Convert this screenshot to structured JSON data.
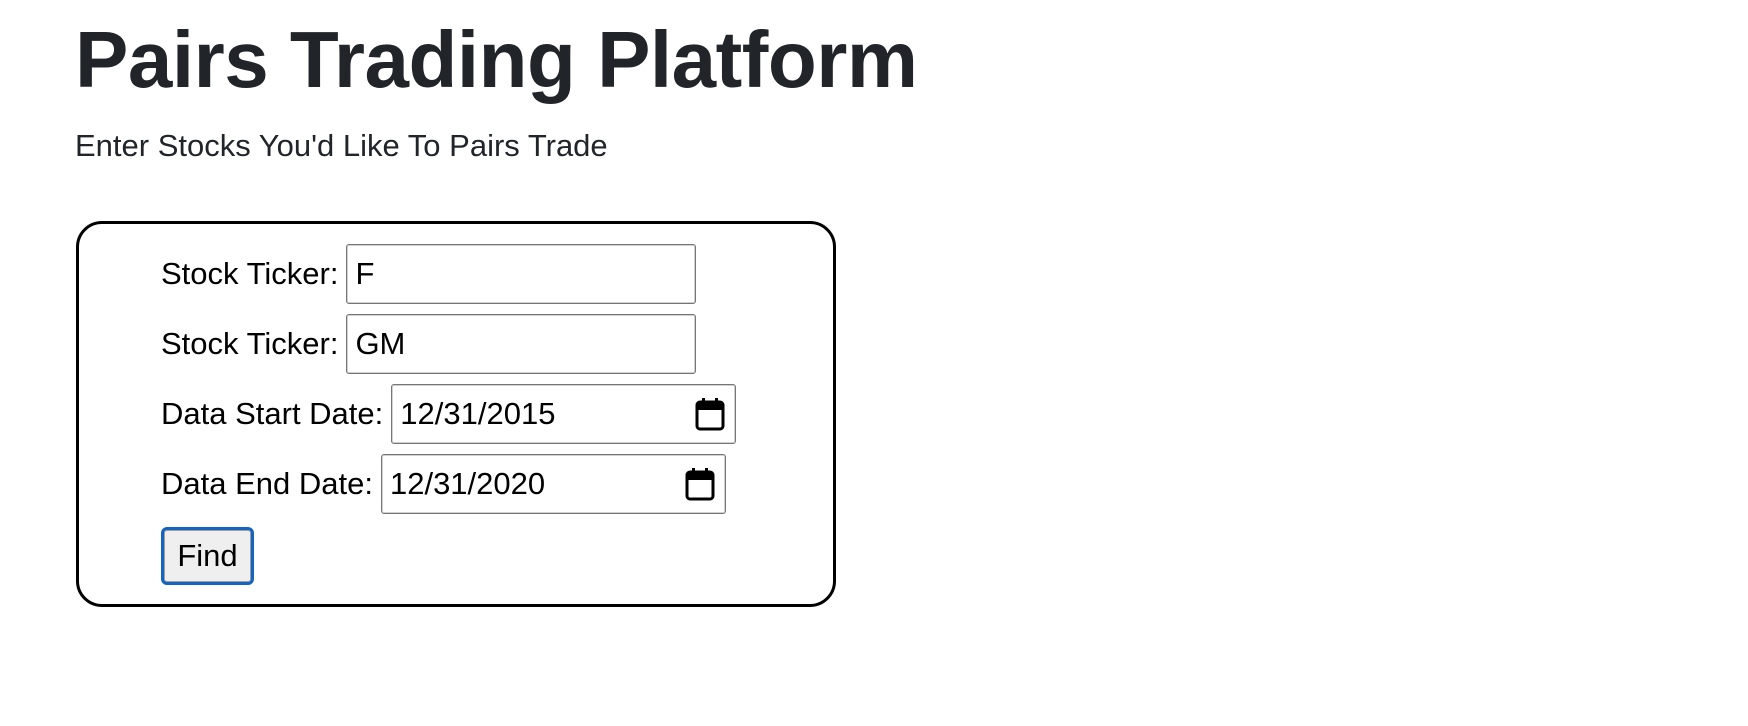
{
  "header": {
    "title": "Pairs Trading Platform",
    "subtitle": "Enter Stocks You'd Like To Pairs Trade"
  },
  "form": {
    "ticker_1": {
      "label": "Stock Ticker:",
      "value": "F"
    },
    "ticker_2": {
      "label": "Stock Ticker:",
      "value": "GM"
    },
    "start_date": {
      "label": "Data Start Date:",
      "value": "12/31/2015",
      "icon": "calendar-icon"
    },
    "end_date": {
      "label": "Data End Date:",
      "value": "12/31/2020",
      "icon": "calendar-icon"
    },
    "submit_label": "Find"
  },
  "colors": {
    "text": "#212529",
    "panel_border": "#000000",
    "button_focus_border": "#1565c0",
    "button_background": "#efefef"
  }
}
